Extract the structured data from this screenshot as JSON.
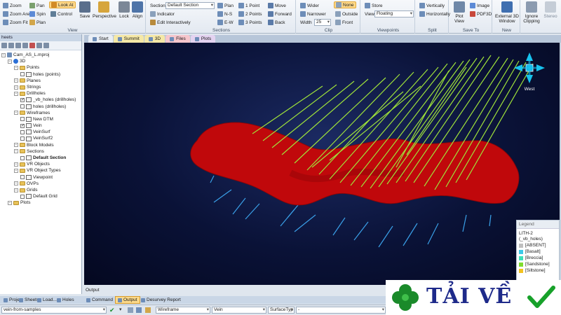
{
  "ribbon": {
    "view_group": {
      "label": "View",
      "small_buttons": [
        "Zoom",
        "Pan",
        "Look At",
        "Zoom Area",
        "Spin",
        "Control",
        "Zoom Fit",
        "Plan"
      ],
      "large_buttons": [
        "Save",
        "Perspective",
        "Lock",
        "Align"
      ]
    },
    "sections_group": {
      "label": "Sections",
      "section_label": "Section",
      "section_value": "Default Section",
      "indicator": "Indicator",
      "edit_interactively": "Edit Interactively",
      "orient_buttons": [
        "Plan",
        "N-S",
        "E-W"
      ],
      "points_buttons": [
        "1 Point",
        "2 Points",
        "3 Points"
      ],
      "nav_buttons": [
        "Move",
        "Forward",
        "Back"
      ]
    },
    "clip_group": {
      "label": "Clip",
      "buttons": [
        "Wider",
        "Narrower"
      ],
      "width_label": "Width",
      "width_value": "25",
      "modes": [
        "None",
        "Outside",
        "Front"
      ]
    },
    "viewpoints_group": {
      "label": "Viewpoints",
      "store": "Store",
      "view_label": "View",
      "view_value": "Floating"
    },
    "split_group": {
      "label": "Split",
      "buttons": [
        "Vertically",
        "Horizontally"
      ]
    },
    "saveto_group": {
      "label": "Save To",
      "plot_view": "Plot View",
      "image": "Image",
      "pdf3d": "PDF3D"
    },
    "new_group": {
      "label": "New",
      "external_window": "External 3D Window"
    },
    "extra": {
      "ignore_clipping": "Ignore Clipping",
      "stereo": "Stereo"
    }
  },
  "sheets_panel": {
    "title": "heets",
    "tree": [
      {
        "label": "Cam_AS_L.mproj",
        "level": 0,
        "type": "project"
      },
      {
        "label": "3D",
        "level": 1,
        "type": "globe"
      },
      {
        "label": "Points",
        "level": 2,
        "type": "folder"
      },
      {
        "label": "holes (points)",
        "level": 3,
        "type": "object"
      },
      {
        "label": "Planes",
        "level": 2,
        "type": "folder"
      },
      {
        "label": "Strings",
        "level": 2,
        "type": "folder"
      },
      {
        "label": "Drillholes",
        "level": 2,
        "type": "folder"
      },
      {
        "label": "_vb_holes (drillholes)",
        "level": 3,
        "type": "object",
        "checked": true
      },
      {
        "label": "holes (drillholes)",
        "level": 3,
        "type": "object"
      },
      {
        "label": "Wireframes",
        "level": 2,
        "type": "folder"
      },
      {
        "label": "New DTM",
        "level": 3,
        "type": "object"
      },
      {
        "label": "Vein",
        "level": 3,
        "type": "object",
        "checked": true
      },
      {
        "label": "VeinSurf",
        "level": 3,
        "type": "object"
      },
      {
        "label": "VeinSurf2",
        "level": 3,
        "type": "object"
      },
      {
        "label": "Block Models",
        "level": 2,
        "type": "folder"
      },
      {
        "label": "Sections",
        "level": 2,
        "type": "folder"
      },
      {
        "label": "Default Section",
        "level": 3,
        "type": "object",
        "bold": true
      },
      {
        "label": "VR Objects",
        "level": 2,
        "type": "folder"
      },
      {
        "label": "VR Object Types",
        "level": 2,
        "type": "folder"
      },
      {
        "label": "Viewpoint",
        "level": 3,
        "type": "object"
      },
      {
        "label": "OVPs",
        "level": 2,
        "type": "folder"
      },
      {
        "label": "Grids",
        "level": 2,
        "type": "folder"
      },
      {
        "label": "Default Grid",
        "level": 3,
        "type": "object"
      },
      {
        "label": "Plots",
        "level": 1,
        "type": "folder"
      }
    ]
  },
  "doc_tabs": [
    {
      "label": "Start",
      "color": "#e9eef5"
    },
    {
      "label": "Summit",
      "color": "#f5e8a6"
    },
    {
      "label": "3D",
      "color": "#f5e8a6"
    },
    {
      "label": "Files",
      "color": "#f6c6cc"
    },
    {
      "label": "Plots",
      "color": "#e4d3f1"
    }
  ],
  "viewport": {
    "compass_label": "West"
  },
  "legend": {
    "title": "Legend",
    "header_lines": [
      "LITH-2",
      "(_vb_holes)"
    ],
    "items": [
      {
        "label": "[ABSENT]",
        "color": "#bfbfbf"
      },
      {
        "label": "[Basalt]",
        "color": "#3bc9e8"
      },
      {
        "label": "[Breccia]",
        "color": "#3ce0b9"
      },
      {
        "label": "[Sandstone]",
        "color": "#7fdc2e"
      },
      {
        "label": "[Siltstone]",
        "color": "#f3c21f"
      }
    ]
  },
  "output": {
    "title": "Output"
  },
  "bottom_tabs": [
    "Proje...",
    "Sheets",
    "Load...",
    "Holes",
    "Command",
    "Output",
    "Desurvey Report"
  ],
  "status_bar": {
    "command_value": "vein-from-samples",
    "wireframe_value": "Wireframe",
    "vein_value": "Vein",
    "surface_value": "SurfaceTyp",
    "extra_value": "-"
  },
  "watermark": {
    "text": "TẢI VỀ"
  },
  "colors": {
    "ribbon_active": "#ffd98a",
    "viewport_bg": "#0a1237",
    "vein_surface": "#c0080b",
    "drillhole_green": "#9fe23a",
    "drillhole_blue": "#3aa0e8"
  }
}
